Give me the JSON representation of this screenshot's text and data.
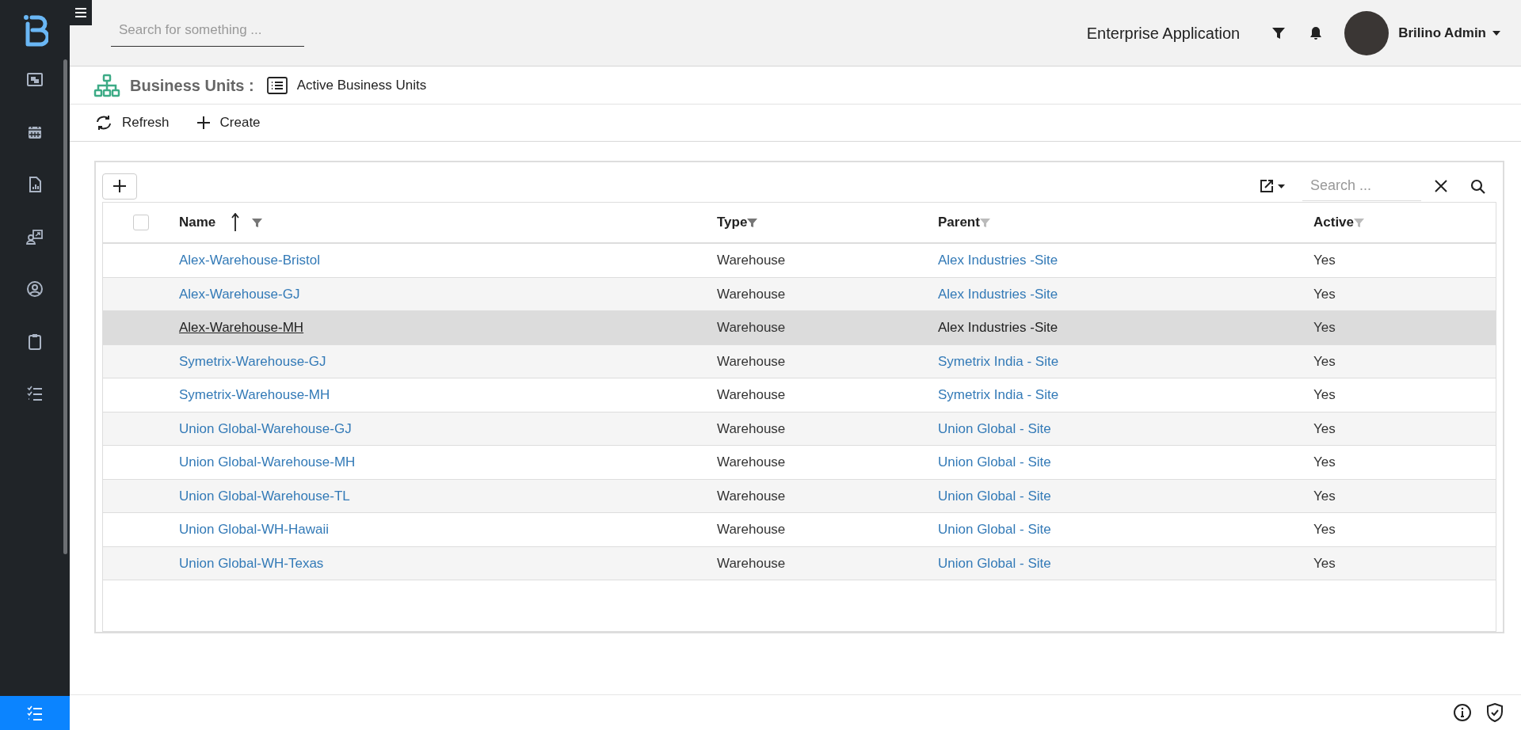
{
  "sidebar": {
    "items": [
      {
        "kind": "gallery",
        "selected": false
      },
      {
        "kind": "calendar",
        "selected": false
      },
      {
        "kind": "report",
        "selected": false
      },
      {
        "kind": "presenter",
        "selected": false
      },
      {
        "kind": "user",
        "selected": false
      },
      {
        "kind": "clipboard",
        "selected": false
      },
      {
        "kind": "checklist",
        "selected": false
      }
    ],
    "bottom_item": {
      "kind": "checklist",
      "selected": true
    }
  },
  "header": {
    "search": {
      "placeholder": "Search for something ..."
    },
    "app_name": "Enterprise Application",
    "user": "Brilino Admin"
  },
  "breadcrumb": {
    "title": "Business Units :",
    "view": "Active Business Units"
  },
  "toolbar": [
    "Refresh",
    "Create"
  ],
  "table": {
    "search": {
      "placeholder": "Search ..."
    },
    "select_all": {
      "checked": false
    },
    "columns": [
      {
        "label": "Name",
        "sorted": true
      },
      {
        "label": "Type",
        "sorted": false
      },
      {
        "label": "Parent",
        "sorted": false
      },
      {
        "label": "Active",
        "sorted": false
      }
    ],
    "rows": [
      {
        "name": "Alex-Warehouse-Bristol",
        "type": "Warehouse",
        "parent": "Alex Industries -Site",
        "active": "Yes",
        "selected": false
      },
      {
        "name": "Alex-Warehouse-GJ",
        "type": "Warehouse",
        "parent": "Alex Industries -Site",
        "active": "Yes",
        "selected": false
      },
      {
        "name": "Alex-Warehouse-MH",
        "type": "Warehouse",
        "parent": "Alex Industries -Site",
        "active": "Yes",
        "selected": true
      },
      {
        "name": "Symetrix-Warehouse-GJ",
        "type": "Warehouse",
        "parent": "Symetrix India - Site",
        "active": "Yes",
        "selected": false
      },
      {
        "name": "Symetrix-Warehouse-MH",
        "type": "Warehouse",
        "parent": "Symetrix India - Site",
        "active": "Yes",
        "selected": false
      },
      {
        "name": "Union Global-Warehouse-GJ",
        "type": "Warehouse",
        "parent": "Union Global - Site",
        "active": "Yes",
        "selected": false
      },
      {
        "name": "Union Global-Warehouse-MH",
        "type": "Warehouse",
        "parent": "Union Global - Site",
        "active": "Yes",
        "selected": false
      },
      {
        "name": "Union Global-Warehouse-TL",
        "type": "Warehouse",
        "parent": "Union Global - Site",
        "active": "Yes",
        "selected": false
      },
      {
        "name": "Union Global-WH-Hawaii",
        "type": "Warehouse",
        "parent": "Union Global - Site",
        "active": "Yes",
        "selected": false
      },
      {
        "name": "Union Global-WH-Texas",
        "type": "Warehouse",
        "parent": "Union Global - Site",
        "active": "Yes",
        "selected": false
      }
    ]
  }
}
